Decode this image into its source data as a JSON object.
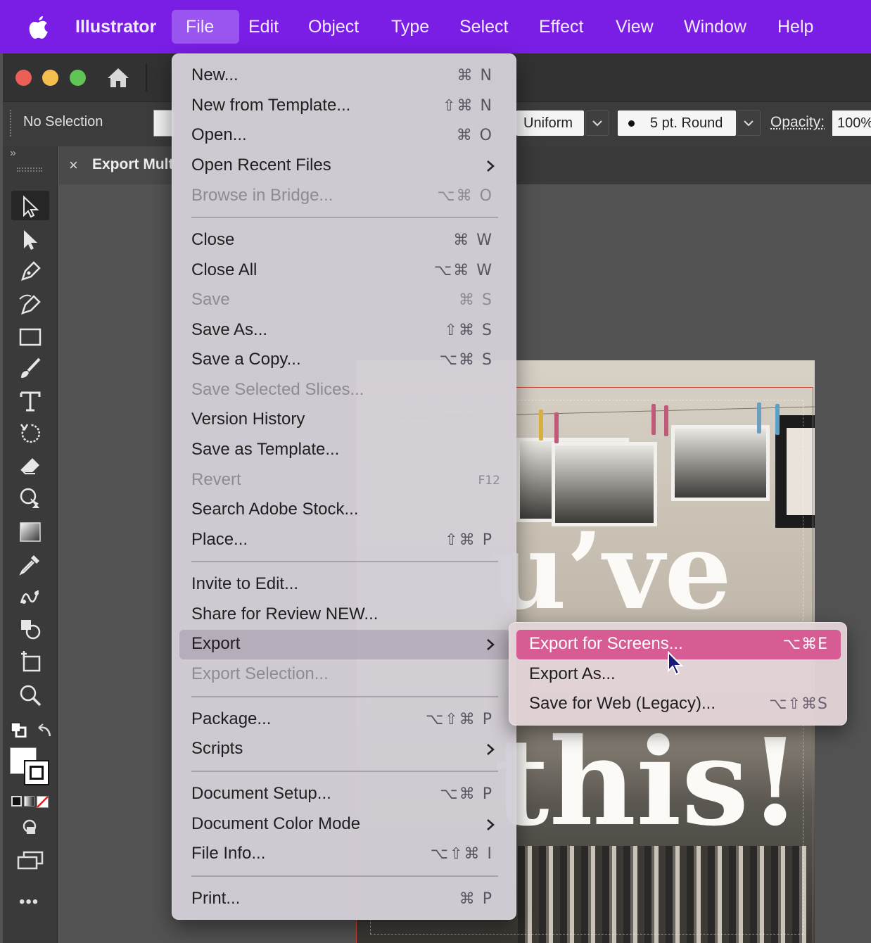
{
  "menubar": {
    "app_name": "Illustrator",
    "items": [
      "File",
      "Edit",
      "Object",
      "Type",
      "Select",
      "Effect",
      "View",
      "Window",
      "Help"
    ],
    "active": "File"
  },
  "control_bar": {
    "selection_status": "No Selection",
    "stroke_profile": "Uniform",
    "brush": "5 pt. Round",
    "opacity_label": "Opacity:",
    "opacity_value": "100%"
  },
  "document_tab": {
    "close": "×",
    "title": "Export Mult"
  },
  "tools_panel": {
    "collapse": "»",
    "more": "•••"
  },
  "file_menu": {
    "items": [
      {
        "label": "New...",
        "shortcut": "⌘ N",
        "disabled": false
      },
      {
        "label": "New from Template...",
        "shortcut": "⇧⌘ N",
        "disabled": false
      },
      {
        "label": "Open...",
        "shortcut": "⌘ O",
        "disabled": false
      },
      {
        "label": "Open Recent Files",
        "submenu": true,
        "disabled": false
      },
      {
        "label": "Browse in Bridge...",
        "shortcut": "⌥⌘ O",
        "disabled": true
      },
      {
        "label": "Close",
        "shortcut": "⌘ W",
        "disabled": false
      },
      {
        "label": "Close All",
        "shortcut": "⌥⌘ W",
        "disabled": false
      },
      {
        "label": "Save",
        "shortcut": "⌘ S",
        "disabled": true
      },
      {
        "label": "Save As...",
        "shortcut": "⇧⌘ S",
        "disabled": false
      },
      {
        "label": "Save a Copy...",
        "shortcut": "⌥⌘ S",
        "disabled": false
      },
      {
        "label": "Save Selected Slices...",
        "disabled": true
      },
      {
        "label": "Version History",
        "disabled": false
      },
      {
        "label": "Save as Template...",
        "disabled": false
      },
      {
        "label": "Revert",
        "shortcut": "F12",
        "disabled": true
      },
      {
        "label": "Search Adobe Stock...",
        "disabled": false
      },
      {
        "label": "Place...",
        "shortcut": "⇧⌘ P",
        "disabled": false
      },
      {
        "label": "Invite to Edit...",
        "disabled": false
      },
      {
        "label": "Share for Review NEW...",
        "disabled": false
      },
      {
        "label": "Export",
        "submenu": true,
        "disabled": false,
        "highlighted": true
      },
      {
        "label": "Export Selection...",
        "disabled": true
      },
      {
        "label": "Package...",
        "shortcut": "⌥⇧⌘ P",
        "disabled": false
      },
      {
        "label": "Scripts",
        "submenu": true,
        "disabled": false
      },
      {
        "label": "Document Setup...",
        "shortcut": "⌥⌘ P",
        "disabled": false
      },
      {
        "label": "Document Color Mode",
        "submenu": true,
        "disabled": false
      },
      {
        "label": "File Info...",
        "shortcut": "⌥⇧⌘ I",
        "disabled": false
      },
      {
        "label": "Print...",
        "shortcut": "⌘ P",
        "disabled": false
      }
    ]
  },
  "export_submenu": {
    "items": [
      {
        "label": "Export for Screens...",
        "shortcut": "⌥⌘E",
        "highlighted": true
      },
      {
        "label": "Export As...",
        "shortcut": ""
      },
      {
        "label": "Save for Web (Legacy)...",
        "shortcut": "⌥⇧⌘S"
      }
    ]
  },
  "artboard": {
    "text_line1": "u’ve",
    "text_line2": "this!"
  },
  "colors": {
    "menubar_bg": "#7a1ee6",
    "submenu_highlight": "#d75c94",
    "traffic_red": "#ec5f59",
    "traffic_yellow": "#f4bf4f",
    "traffic_green": "#61c554"
  }
}
